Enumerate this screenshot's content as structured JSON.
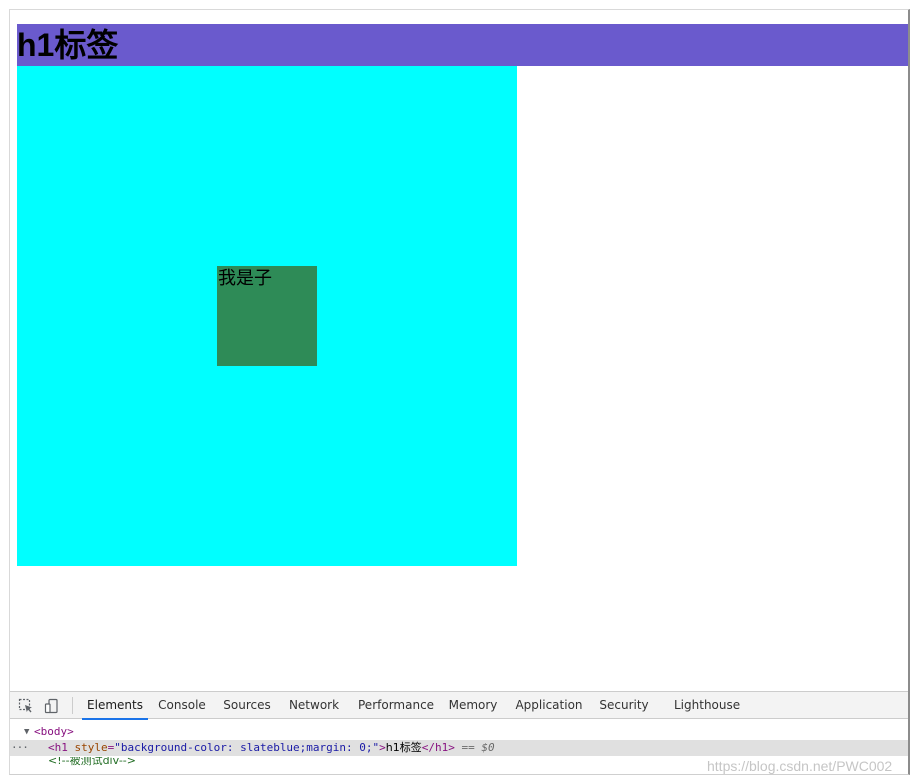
{
  "page": {
    "h1_text": "h1标签",
    "child_text": "我是子"
  },
  "colors": {
    "h1_background": "#6a5acd",
    "parent_background": "#00ffff",
    "child_background": "#2e8b57",
    "devtools_toolbar": "#f3f3f3",
    "active_tab_underline": "#1a73e8"
  },
  "devtools": {
    "toolbar_icons": [
      "inspect-element-icon",
      "device-toolbar-icon"
    ],
    "tabs": [
      {
        "label": "Elements",
        "active": true
      },
      {
        "label": "Console",
        "active": false
      },
      {
        "label": "Sources",
        "active": false
      },
      {
        "label": "Network",
        "active": false
      },
      {
        "label": "Performance",
        "active": false
      },
      {
        "label": "Memory",
        "active": false
      },
      {
        "label": "Application",
        "active": false
      },
      {
        "label": "Security",
        "active": false
      },
      {
        "label": "Lighthouse",
        "active": false
      }
    ],
    "dom_tree": {
      "body_tag": "<body>",
      "selected_line": {
        "ellipsis": "···",
        "open_tag": "<h1",
        "attr_name": "style",
        "attr_value": "\"background-color: slateblue;margin: 0;\"",
        "close_open": ">",
        "text": "h1标签",
        "close_tag": "</h1>",
        "console_ref": "== $0"
      },
      "next_line": "<!--被测试div-->"
    }
  },
  "watermark": "https://blog.csdn.net/PWC002"
}
